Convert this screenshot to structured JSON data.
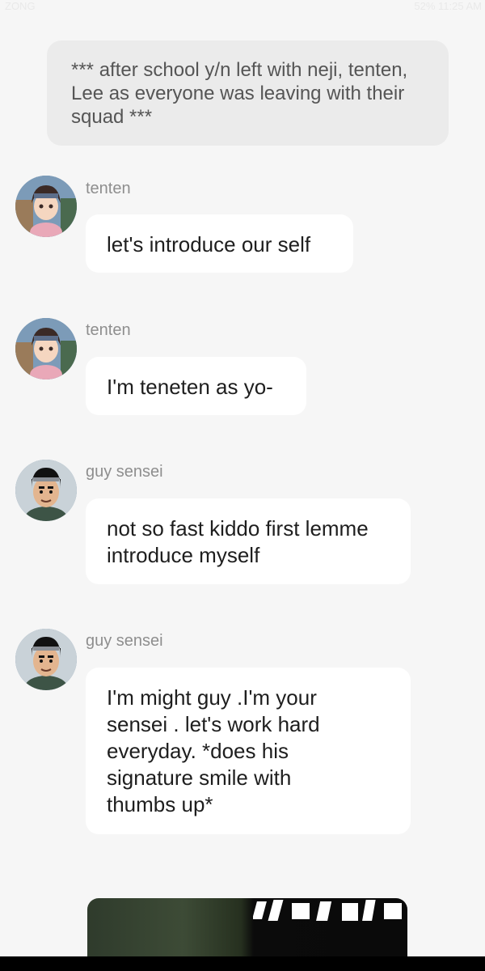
{
  "status_bar": {
    "carrier": "ZONG",
    "right_text": "52% 11:25 AM"
  },
  "narration": {
    "text": "*** after school y/n left with neji, tenten, Lee as everyone was leaving with their squad ***"
  },
  "messages": [
    {
      "sender": "tenten",
      "text": "let's introduce our self"
    },
    {
      "sender": "tenten",
      "text": "I'm teneten as yo-"
    },
    {
      "sender": "guy sensei",
      "text": "not so fast kiddo first lemme introduce myself"
    },
    {
      "sender": "guy sensei",
      "text": "I'm might guy .I'm your sensei . let's work hard everyday. *does his signature smile with thumbs up*"
    }
  ],
  "colors": {
    "background": "#f6f6f6",
    "bubble": "#ffffff",
    "narration_bg": "#ebebeb",
    "sender_text": "#8e8e8e"
  },
  "icons": {
    "avatar_tenten": "tenten-avatar",
    "avatar_guy": "guy-sensei-avatar"
  }
}
